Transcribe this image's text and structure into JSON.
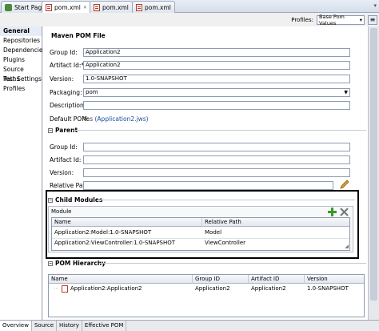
{
  "tabs": [
    {
      "label": "Start Page"
    },
    {
      "label": "pom.xml"
    },
    {
      "label": "pom.xml"
    },
    {
      "label": "pom.xml"
    }
  ],
  "profiles": {
    "label": "Profiles:",
    "value": "Base Pom Values"
  },
  "sidebar": {
    "items": [
      {
        "label": "General"
      },
      {
        "label": "Repositories"
      },
      {
        "label": "Dependencies"
      },
      {
        "label": "Plugins"
      },
      {
        "label": "Source Paths"
      },
      {
        "label": "Test Settings"
      },
      {
        "label": "Profiles"
      }
    ]
  },
  "pom": {
    "title": "Maven POM File",
    "group_id_label": "Group Id:",
    "group_id": "Application2",
    "artifact_id_label": "Artifact Id:*",
    "artifact_id": "Application2",
    "version_label": "Version:",
    "version": "1.0-SNAPSHOT",
    "packaging_label": "Packaging:",
    "packaging": "pom",
    "description_label": "Description:",
    "description": "",
    "default_pom_label": "Default POM:",
    "default_pom_yes": "Yes",
    "default_pom_link": "(Application2.jws)"
  },
  "parent": {
    "title": "Parent",
    "group_id_label": "Group Id:",
    "artifact_id_label": "Artifact Id:",
    "version_label": "Version:",
    "relative_path_label": "Relative Path:"
  },
  "child_modules": {
    "title": "Child Modules",
    "panel_label": "Module",
    "columns": [
      "Name",
      "Relative Path"
    ],
    "rows": [
      {
        "name": "Application2:Model:1.0-SNAPSHOT",
        "path": "Model"
      },
      {
        "name": "Application2:ViewController:1.0-SNAPSHOT",
        "path": "ViewController"
      }
    ]
  },
  "pom_hierarchy": {
    "title": "POM Hierarchy",
    "columns": [
      "Name",
      "Group ID",
      "Artifact ID",
      "Version"
    ],
    "rows": [
      {
        "name": "Application2:Application2",
        "group": "Application2",
        "artifact": "Application2",
        "version": "1.0-SNAPSHOT"
      }
    ]
  },
  "bottom_tabs": [
    {
      "label": "Overview"
    },
    {
      "label": "Source"
    },
    {
      "label": "History"
    },
    {
      "label": "Effective POM"
    }
  ],
  "colors": {
    "accent": "#1c4fa0",
    "callout_border": "#000000",
    "add_icon": "#3a9a2a",
    "remove_icon": "#7a7a7a"
  }
}
